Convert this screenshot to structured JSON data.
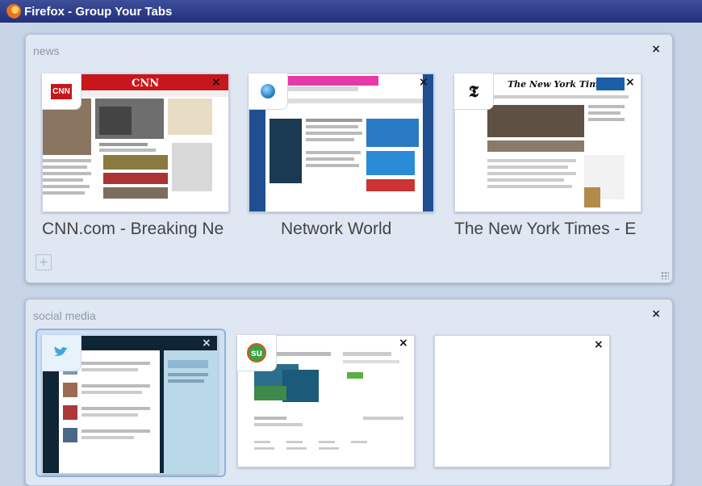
{
  "window": {
    "title": "Firefox - Group Your Tabs",
    "icon": "firefox-icon"
  },
  "groups": [
    {
      "title": "news",
      "tabs": [
        {
          "label": "CNN.com - Breaking Ne",
          "favicon": "cnn-icon",
          "favicon_text": "CNN"
        },
        {
          "label": "Network World",
          "favicon": "globe-icon"
        },
        {
          "label": "The New York Times - E",
          "favicon": "nyt-icon",
          "favicon_text": "𝕿"
        }
      ],
      "new_tab_icon": "plus-icon"
    },
    {
      "title": "social media",
      "tabs": [
        {
          "label": "",
          "favicon": "twitter-bird-icon"
        },
        {
          "label": "",
          "favicon": "stumbleupon-icon"
        },
        {
          "label": "",
          "favicon": ""
        }
      ]
    }
  ],
  "close_glyph": "×",
  "colors": {
    "titlebar": "#2a3580",
    "background": "#c7d4e6",
    "group": "#dfe7f3"
  }
}
